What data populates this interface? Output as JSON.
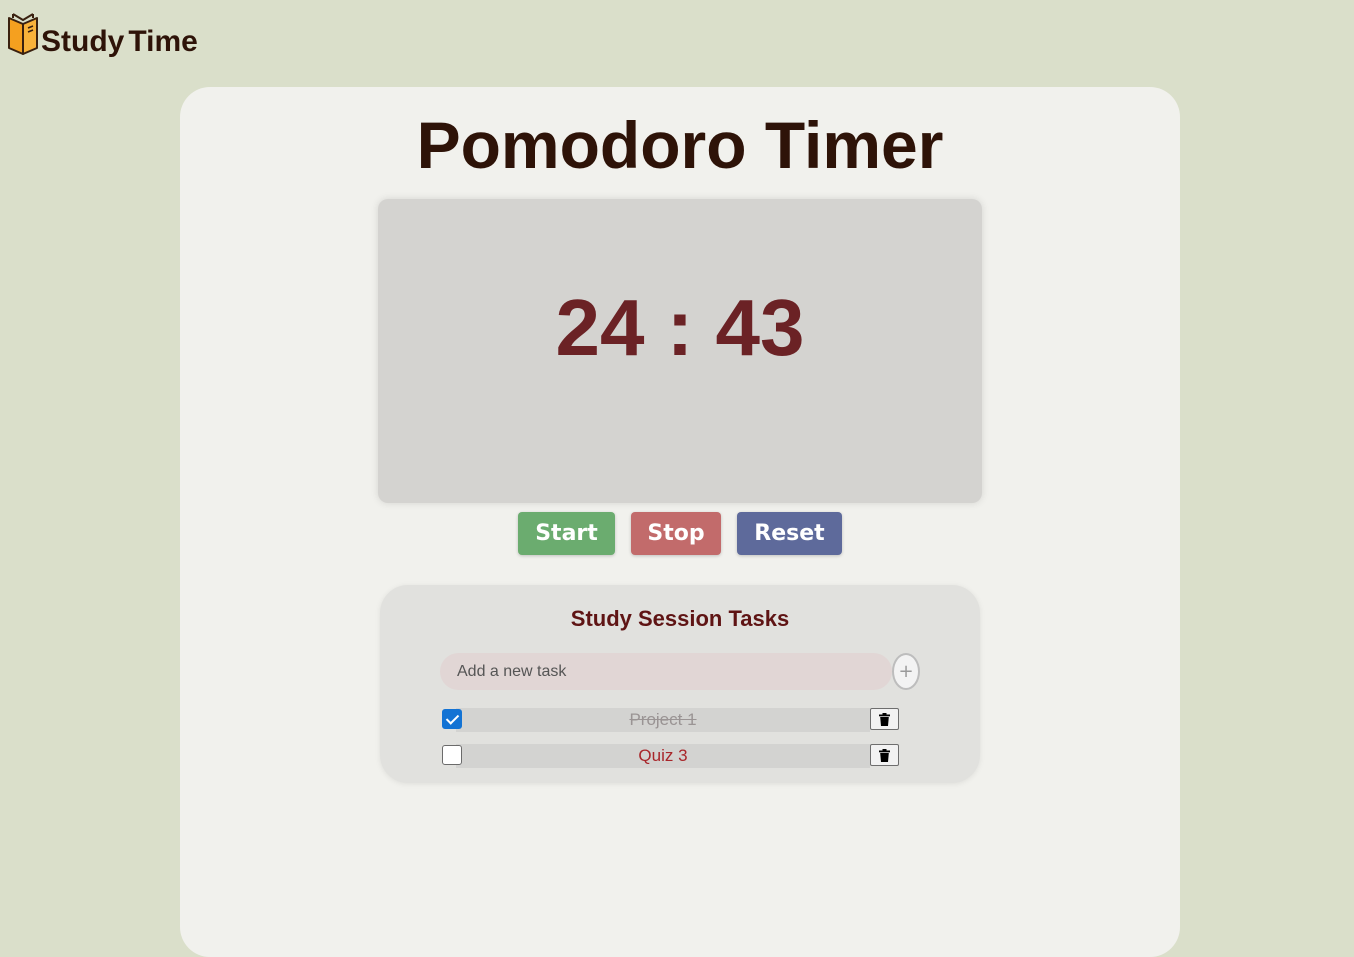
{
  "brand": {
    "name_part1": "Study",
    "name_part2": "Time"
  },
  "title": "Pomodoro Timer",
  "timer": {
    "minutes": "24",
    "separator": ":",
    "seconds": "43",
    "display": "24 : 43"
  },
  "controls": {
    "start_label": "Start",
    "stop_label": "Stop",
    "reset_label": "Reset"
  },
  "tasks": {
    "title": "Study Session Tasks",
    "input_placeholder": "Add a new task",
    "add_label": "+",
    "items": [
      {
        "label": "Project 1",
        "completed": true
      },
      {
        "label": "Quiz 3",
        "completed": false
      }
    ]
  },
  "colors": {
    "page_background": "#dadfca",
    "panel_background": "#f1f1ed",
    "timer_text": "#6b2225",
    "start": "#6bac6f",
    "stop": "#c26b6b",
    "reset": "#5e6a9b",
    "checkbox_checked": "#1373d4"
  },
  "icons": {
    "logo": "book-icon",
    "delete": "trash-icon",
    "add": "plus-icon"
  }
}
